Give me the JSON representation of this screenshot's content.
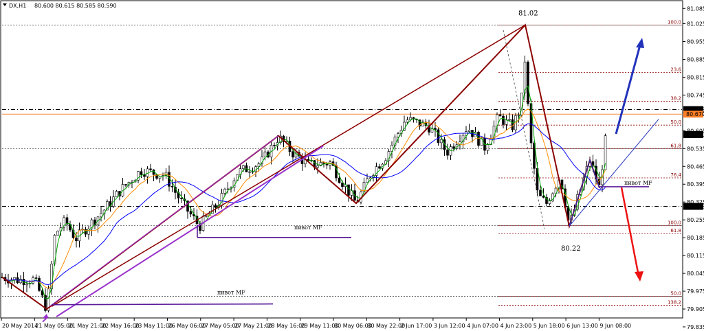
{
  "header": {
    "symbol": "DX,H1",
    "quote": "80.600 80.615 80.585 80.590"
  },
  "chart_data": {
    "type": "candlestick",
    "timeframe": "H1",
    "ylim": [
      79.87,
      81.11
    ],
    "y_ticks": [
      "81.085",
      "81.025",
      "80.955",
      "80.885",
      "80.815",
      "80.745",
      "80.675",
      "80.605",
      "80.535",
      "80.465",
      "80.395",
      "80.325",
      "80.255",
      "80.185",
      "80.115",
      "80.045",
      "79.975",
      "79.905",
      "79.835"
    ],
    "x_ticks": [
      "20 May 2014",
      "21 May 05:00",
      "21 May 21:00",
      "22 May 16:00",
      "23 May 11:00",
      "26 May 06:00",
      "27 May 05:00",
      "27 May 21:00",
      "28 May 16:00",
      "29 May 11:00",
      "30 May 06:00",
      "30 May 22:00",
      "2 Jun 17:00",
      "3 Jun 12:00",
      "4 Jun 07:00",
      "4 Jun 23:00",
      "5 Jun 18:00",
      "6 Jun 13:00",
      "9 Jun 08:00"
    ],
    "price_badges": [
      {
        "label": "80.688",
        "value": 80.688,
        "style": "dark"
      },
      {
        "label": "80.670",
        "value": 80.67,
        "style": "orange"
      },
      {
        "label": "80.590",
        "value": 80.59,
        "style": "dark"
      },
      {
        "label": "80.308",
        "value": 80.308,
        "style": "dark"
      }
    ],
    "horizontal_lines": [
      {
        "value": 80.688,
        "style": "dashdot",
        "color": "#000000"
      },
      {
        "value": 80.67,
        "style": "solid",
        "color": "#ff8c40"
      },
      {
        "value": 80.308,
        "style": "dashdot",
        "color": "#000000"
      }
    ],
    "fib_upper": [
      {
        "label": "100.0",
        "value": 81.02
      },
      {
        "label": "23.6",
        "value": 80.834
      },
      {
        "label": "38.2",
        "value": 80.72
      },
      {
        "label": "50.0",
        "value": 80.627
      },
      {
        "label": "61.8",
        "value": 80.535
      },
      {
        "label": "76.4",
        "value": 80.42
      },
      {
        "label": "100.0",
        "value": 80.232
      },
      {
        "label": "61.8",
        "value": 80.202
      }
    ],
    "fib_lower": [
      {
        "label": "50.0",
        "value": 79.955
      },
      {
        "label": "138.2",
        "value": 79.92
      }
    ],
    "annotations": {
      "high_label": "81.02",
      "low_label": "80.22",
      "pivot_labels": [
        "пивот MF",
        "пивот MF",
        "пивот MF"
      ]
    },
    "key_prices": [
      {
        "x": "20 May 2014",
        "y": 80.03
      },
      {
        "x": "21 May 05:00",
        "y": 79.9
      },
      {
        "x": "28 May 16:00",
        "y": 80.59
      },
      {
        "x": "30 May 06:00",
        "y": 80.31
      },
      {
        "x": "4 Jun 23:00",
        "y": 81.02
      },
      {
        "x": "6 Jun 13:00",
        "y": 80.22
      },
      {
        "x": "9 Jun 08:00",
        "y": 80.59
      }
    ],
    "colors": {
      "price_line": "#000000",
      "ma_fast": "#00aa00",
      "ma_mid": "#ff8c00",
      "ma_slow": "#0000ff",
      "zigzag": "#8b0000",
      "channel": "#9932cc",
      "pivot": "#5a1a9a",
      "arrow_up": "#2233bb",
      "arrow_down": "#ee1111",
      "fib": "#8b0000"
    }
  }
}
